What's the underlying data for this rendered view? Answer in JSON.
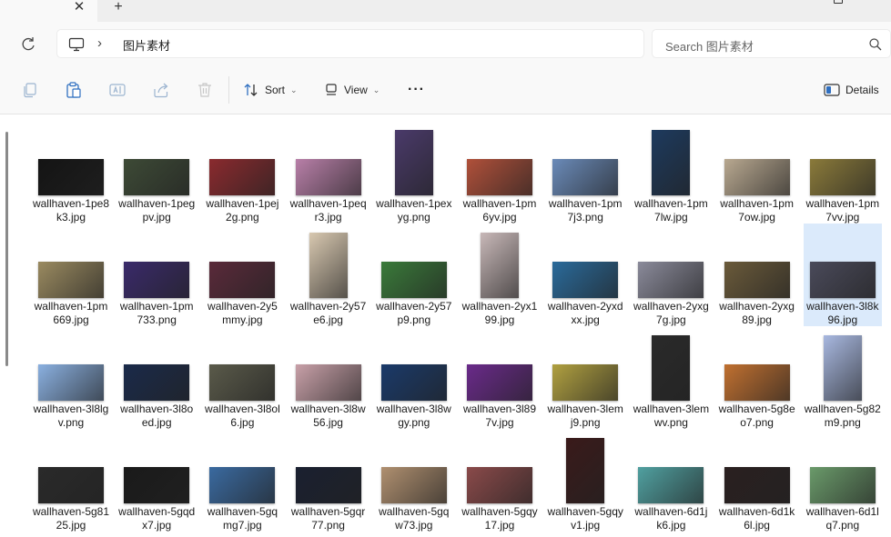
{
  "tabs": {
    "close_glyph": "✕",
    "new_glyph": "+"
  },
  "address": {
    "location_icon": "pc-icon",
    "separator": "›",
    "breadcrumb": "图片素材"
  },
  "search": {
    "placeholder": "Search 图片素材",
    "icon": "search-icon"
  },
  "toolbar": {
    "copy_icon": "copy-icon",
    "paste_icon": "paste-icon",
    "rename_icon": "rename-icon",
    "share_icon": "share-icon",
    "delete_icon": "delete-icon",
    "sort_label": "Sort",
    "view_label": "View",
    "more_label": "···",
    "details_label": "Details"
  },
  "files": [
    {
      "name": "wallhaven-1pe8k3.jpg",
      "orientation": "landscape",
      "color": "#141414"
    },
    {
      "name": "wallhaven-1pegpv.jpg",
      "orientation": "landscape",
      "color": "#3d4a36"
    },
    {
      "name": "wallhaven-1pej2g.png",
      "orientation": "landscape",
      "color": "#8a2a2e"
    },
    {
      "name": "wallhaven-1peqr3.jpg",
      "orientation": "landscape",
      "color": "#b87fa8"
    },
    {
      "name": "wallhaven-1pexyg.png",
      "orientation": "portrait",
      "color": "#4a3a6a"
    },
    {
      "name": "wallhaven-1pm6yv.jpg",
      "orientation": "landscape",
      "color": "#b0503a"
    },
    {
      "name": "wallhaven-1pm7j3.png",
      "orientation": "landscape",
      "color": "#6a8ab8"
    },
    {
      "name": "wallhaven-1pm7lw.jpg",
      "orientation": "portrait",
      "color": "#1d3a5e"
    },
    {
      "name": "wallhaven-1pm7ow.jpg",
      "orientation": "landscape",
      "color": "#b8a890"
    },
    {
      "name": "wallhaven-1pm7vv.jpg",
      "orientation": "landscape",
      "color": "#8a7a3a"
    },
    {
      "name": "wallhaven-1pm669.jpg",
      "orientation": "landscape",
      "color": "#9a8a60"
    },
    {
      "name": "wallhaven-1pm733.png",
      "orientation": "landscape",
      "color": "#3a2a6a"
    },
    {
      "name": "wallhaven-2y5mmy.jpg",
      "orientation": "landscape",
      "color": "#5a2a3a"
    },
    {
      "name": "wallhaven-2y57e6.jpg",
      "orientation": "portrait",
      "color": "#d8c8b0"
    },
    {
      "name": "wallhaven-2y57p9.png",
      "orientation": "landscape",
      "color": "#3a7a3a"
    },
    {
      "name": "wallhaven-2yx199.jpg",
      "orientation": "portrait",
      "color": "#c8b8b8"
    },
    {
      "name": "wallhaven-2yxdxx.jpg",
      "orientation": "landscape",
      "color": "#2a6a9a"
    },
    {
      "name": "wallhaven-2yxg7g.jpg",
      "orientation": "landscape",
      "color": "#8a8a9a"
    },
    {
      "name": "wallhaven-2yxg89.jpg",
      "orientation": "landscape",
      "color": "#6a5a3a"
    },
    {
      "name": "wallhaven-3l8k96.jpg",
      "orientation": "landscape",
      "color": "#4a4a5a",
      "selected": true
    },
    {
      "name": "wallhaven-3l8lgv.png",
      "orientation": "landscape",
      "color": "#8ab0e0"
    },
    {
      "name": "wallhaven-3l8oed.jpg",
      "orientation": "landscape",
      "color": "#1a2a4a"
    },
    {
      "name": "wallhaven-3l8ol6.jpg",
      "orientation": "landscape",
      "color": "#5a5a4a"
    },
    {
      "name": "wallhaven-3l8w56.jpg",
      "orientation": "landscape",
      "color": "#c8a0a8"
    },
    {
      "name": "wallhaven-3l8wgy.png",
      "orientation": "landscape",
      "color": "#1a3a6a"
    },
    {
      "name": "wallhaven-3l897v.jpg",
      "orientation": "landscape",
      "color": "#6a2a8a"
    },
    {
      "name": "wallhaven-3lemj9.png",
      "orientation": "landscape",
      "color": "#b0a040"
    },
    {
      "name": "wallhaven-3lemwv.png",
      "orientation": "portrait",
      "color": "#2a2a2a"
    },
    {
      "name": "wallhaven-5g8eo7.png",
      "orientation": "landscape",
      "color": "#c07030"
    },
    {
      "name": "wallhaven-5g82m9.png",
      "orientation": "portrait",
      "color": "#a8b8e0"
    },
    {
      "name": "wallhaven-5g8125.jpg",
      "orientation": "landscape",
      "color": "#2a2a2a"
    },
    {
      "name": "wallhaven-5gqdx7.jpg",
      "orientation": "landscape",
      "color": "#1a1a1a"
    },
    {
      "name": "wallhaven-5gqmg7.jpg",
      "orientation": "landscape",
      "color": "#3a6aa0"
    },
    {
      "name": "wallhaven-5gqr77.png",
      "orientation": "landscape",
      "color": "#1a2030"
    },
    {
      "name": "wallhaven-5gqw73.jpg",
      "orientation": "landscape",
      "color": "#b09070"
    },
    {
      "name": "wallhaven-5gqy17.jpg",
      "orientation": "landscape",
      "color": "#8a4a4a"
    },
    {
      "name": "wallhaven-5gqyv1.jpg",
      "orientation": "portrait",
      "color": "#3a1a1a"
    },
    {
      "name": "wallhaven-6d1jk6.jpg",
      "orientation": "landscape",
      "color": "#50a0a0"
    },
    {
      "name": "wallhaven-6d1k6l.jpg",
      "orientation": "landscape",
      "color": "#2a2020"
    },
    {
      "name": "wallhaven-6d1lq7.png",
      "orientation": "landscape",
      "color": "#6a9a6a"
    }
  ]
}
